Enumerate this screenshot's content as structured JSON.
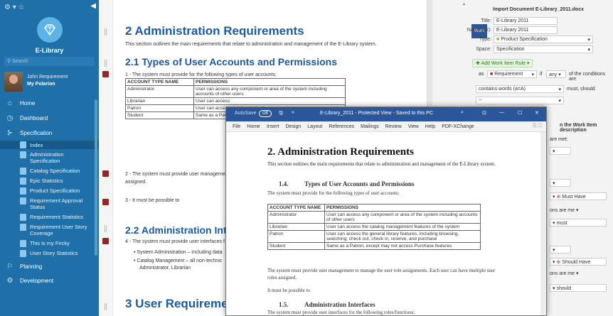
{
  "sidebar": {
    "app_name": "E-Library",
    "search_placeholder": "Search",
    "user_name": "John Requirement",
    "user_link": "My Polarion",
    "nav": {
      "home": "Home",
      "dashboard": "Dashboard",
      "specification": "Specification",
      "planning": "Planning",
      "development": "Development"
    },
    "items": [
      "Index",
      "Administration Specification",
      "Catalog Specification",
      "Epic Statistics",
      "Product Specification",
      "Requirement Approval Status",
      "Requirement Statistics",
      "Requirement User Story Coverage",
      "This is my Fricky",
      "User Story Statistics"
    ]
  },
  "doc": {
    "h1": "2 Administration Requirements",
    "intro": "This section outlines the main requirements that relate to administration and management of the E-Library system.",
    "h2a": "2.1 Types of User Accounts and Permissions",
    "req1": "1 - The system must provide for the following types of user accounts:",
    "table_headers": [
      "ACCOUNT TYPE NAME",
      "PERMISSIONS"
    ],
    "table_rows": [
      [
        "Administrator",
        "User can access any component or area of the system including accounts of other users"
      ],
      [
        "Librarian",
        "User can access"
      ],
      [
        "Patron",
        "User can access check out, check"
      ],
      [
        "Student",
        "Same as a Patron"
      ]
    ],
    "req2": "2 - The system must provide user manageme",
    "req2b": "assigned.",
    "req3": "3 - It must be possible to",
    "h2b": "2.2 Administration Inter",
    "req4": "4 - The system must provide user interfaces f",
    "bullet1": "System Administration – including data",
    "bullet2": "Catalog Management – all non-technic",
    "bullet2b": "Administrator, Librarian",
    "h1b": "3 User Requirement"
  },
  "rpanel": {
    "title": "Import Document E-Library_2011.docx",
    "title_label": "Title:",
    "title_val": "E-Library 2011",
    "name_label": "Name (ID):",
    "name_val": "E-Library 2011",
    "type_label": "Type:",
    "type_val": "Product Specification",
    "space_label": "Space:",
    "space_val": "Specification",
    "word_badge": "Word",
    "add_rule": "Add Work Item Rule",
    "rule_as": "as",
    "rule_req": "Requirement",
    "rule_if": "if",
    "rule_any": "any",
    "rule_cond": "of the conditions are",
    "contains": "contains words (a=A)",
    "must_should": "must, should",
    "dashes": "--",
    "n_work": "n the Work Item description",
    "are_met": "are met:",
    "must_have": "Must Have",
    "ons_are_me": "ons are me",
    "must": "must",
    "should_have": "Should Have",
    "should": "should"
  },
  "word": {
    "autosave": "AutoSave",
    "autosave_state": "Off",
    "title": "E-Library_2011 - Protected View - Saved to this PC",
    "menu": [
      "File",
      "Home",
      "Insert",
      "Design",
      "Layout",
      "References",
      "Mailings",
      "Review",
      "View",
      "Help",
      "PDF-XChange"
    ],
    "h1": "2. Administration Requirements",
    "intro": "This section outlines the main requirements that relate to administration and management of the E-Library system.",
    "h14": "1.4.",
    "h14t": "Types of User Accounts and Permissions",
    "p1": "The system must provide for the following types of user accounts:",
    "table_headers": [
      "ACCOUNT TYPE NAME",
      "PERMISSIONS"
    ],
    "table_rows": [
      [
        "Administrator",
        "User can access any component or area of the system including accounts of other users"
      ],
      [
        "Librarian",
        "User can access the catalog management features of the system"
      ],
      [
        "Patron",
        "User can access the general library features, including browsing, searching, check out, check in, reserve, and purchase"
      ],
      [
        "Student",
        "Same as a Patron, except may not access Purchase features"
      ]
    ],
    "p2": "The system must provide user management to manage the user role assignments. Each user can have multiple user roles assigned.",
    "p3": "It must be possible to",
    "h15": "1.5.",
    "h15t": "Administration Interfaces",
    "p4": "The system must provide user interfaces for the following roles/functions:"
  },
  "colors": {
    "sidebar": "#1f6fa8",
    "heading": "#1b5aa0",
    "word_title": "#2b579a"
  }
}
